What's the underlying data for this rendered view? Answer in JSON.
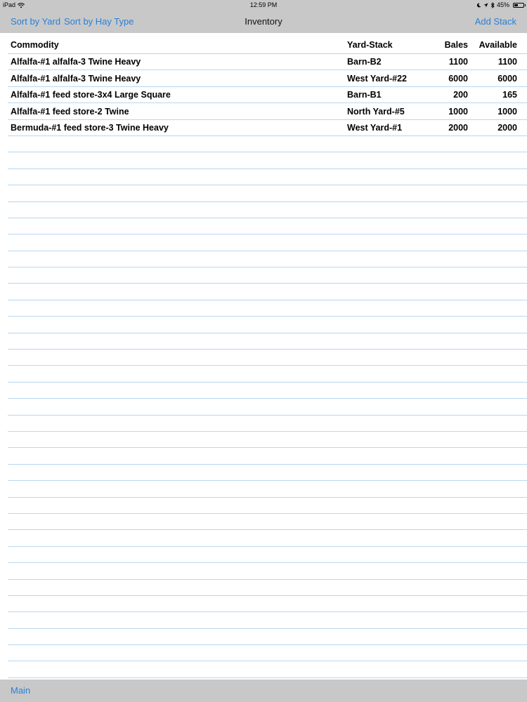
{
  "status_bar": {
    "device": "iPad",
    "time": "12:59 PM",
    "battery": "45%",
    "battery_level": 0.45,
    "icons": [
      "wifi-icon",
      "moon-icon",
      "location-icon",
      "bluetooth-icon",
      "battery-icon"
    ]
  },
  "nav": {
    "sort_by_yard": "Sort by Yard",
    "sort_by_hay_type": "Sort by Hay Type",
    "title": "Inventory",
    "add_stack": "Add Stack",
    "accent_color": "#2b7fd4",
    "bar_color": "#c8c8c9"
  },
  "table": {
    "columns": {
      "commodity": "Commodity",
      "yard_stack": "Yard-Stack",
      "bales": "Bales",
      "available": "Available"
    },
    "rows": [
      {
        "commodity": "Alfalfa-#1 alfalfa-3 Twine Heavy",
        "yard_stack": "Barn-B2",
        "bales": "1100",
        "available": "1100"
      },
      {
        "commodity": "Alfalfa-#1 alfalfa-3 Twine Heavy",
        "yard_stack": "West Yard-#22",
        "bales": "6000",
        "available": "6000"
      },
      {
        "commodity": "Alfalfa-#1 feed store-3x4 Large Square",
        "yard_stack": "Barn-B1",
        "bales": "200",
        "available": "165"
      },
      {
        "commodity": "Alfalfa-#1 feed store-2 Twine",
        "yard_stack": "North Yard-#5",
        "bales": "1000",
        "available": "1000"
      },
      {
        "commodity": "Bermuda-#1 feed store-3 Twine Heavy",
        "yard_stack": "West Yard-#1",
        "bales": "2000",
        "available": "2000"
      }
    ],
    "line_color": "#b9d7ef"
  },
  "toolbar": {
    "main": "Main"
  }
}
